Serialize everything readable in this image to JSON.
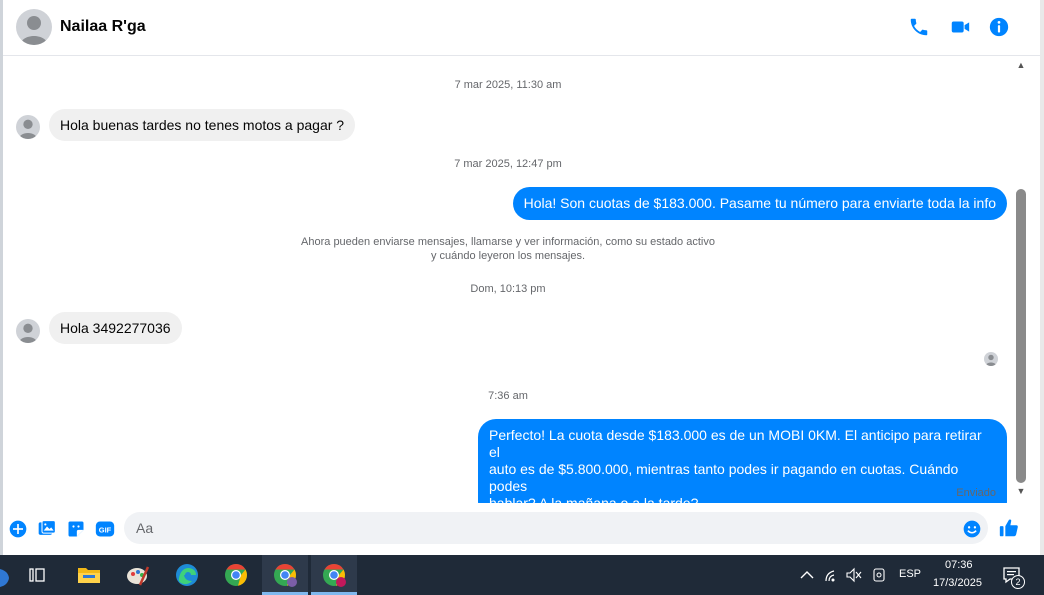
{
  "header": {
    "contact_name": "Nailaa R'ga",
    "icons": [
      "phone-icon",
      "video-call-icon",
      "info-icon"
    ],
    "accent": "#0084ff"
  },
  "messages": [
    {
      "type": "timestamp",
      "text": "7 mar 2025, 11:30 am"
    },
    {
      "type": "incoming",
      "text": "Hola buenas tardes no tenes motos a pagar ?"
    },
    {
      "type": "timestamp",
      "text": "7 mar 2025, 12:47 pm"
    },
    {
      "type": "outgoing",
      "text": "Hola! Son cuotas de $183.000. Pasame tu número para enviarte toda la info"
    },
    {
      "type": "notice",
      "line1": "Ahora pueden enviarse mensajes, llamarse y ver información, como su estado activo",
      "line2": "y cuándo leyeron los mensajes."
    },
    {
      "type": "timestamp",
      "text": "Dom, 10:13 pm"
    },
    {
      "type": "incoming",
      "text": "Hola 3492277036"
    },
    {
      "type": "timestamp",
      "text": "7:36 am"
    },
    {
      "type": "outgoing",
      "line1": "Perfecto! La cuota desde $183.000 es de un MOBI 0KM. El anticipo para retirar el",
      "line2": "auto es de $5.800.000, mientras tanto podes ir pagando en cuotas. Cuándo podes",
      "line3": "hablar? A la mañana o a la tarde?"
    }
  ],
  "status": {
    "sent_label": "Enviado"
  },
  "composer": {
    "placeholder": "Aa",
    "icons": [
      "plus-icon",
      "gallery-icon",
      "sticker-icon",
      "gif-icon",
      "emoji-icon",
      "like-icon"
    ],
    "gif_label": "GIF"
  },
  "taskbar": {
    "apps": [
      "task-view-icon",
      "file-explorer-icon",
      "paint-icon",
      "edge-icon",
      "chrome-icon",
      "chrome-profile-icon",
      "chrome-profile-active-icon"
    ],
    "language": "ESP",
    "time": "07:36",
    "date": "17/3/2025",
    "notifications": "2"
  }
}
